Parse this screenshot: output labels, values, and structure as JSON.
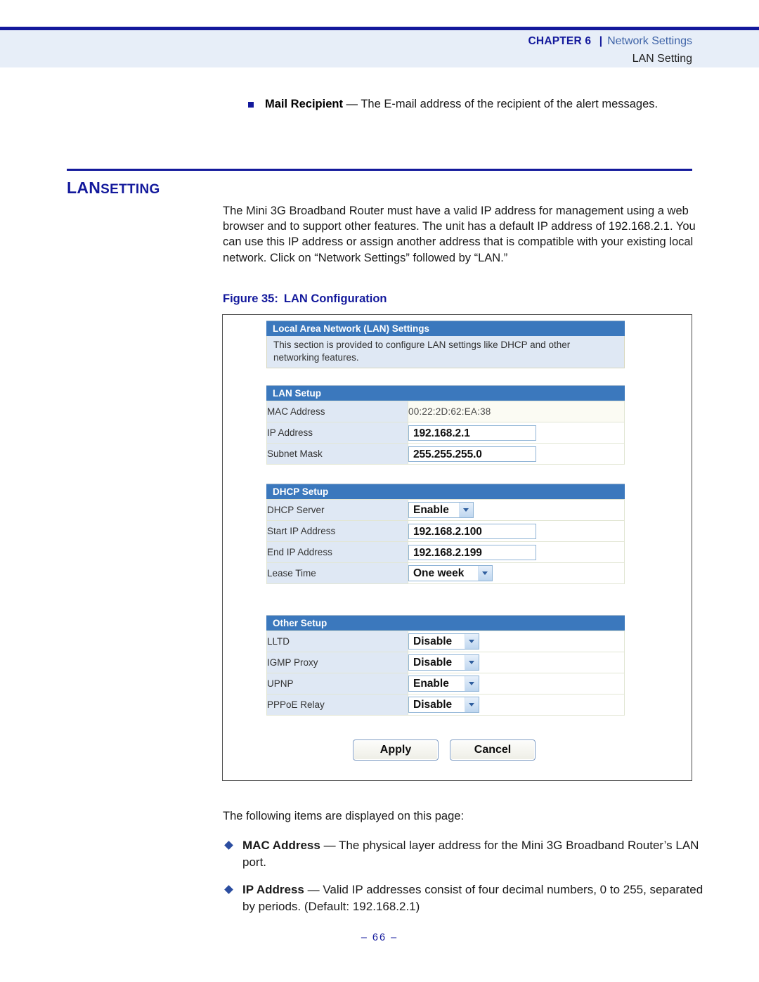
{
  "header": {
    "chapter_label": "CHAPTER",
    "chapter_number": "6",
    "separator": "|",
    "topic": "Network Settings",
    "subtitle": "LAN Setting"
  },
  "mail_recipient_item": {
    "bullet_icon": "square-bullet-icon",
    "term": "Mail Recipient",
    "dash": " — ",
    "description": "The E-mail address of the recipient of the alert messages."
  },
  "section": {
    "title_main": "LAN",
    "title_small": "SETTING",
    "intro": "The Mini 3G Broadband Router must have a valid IP address for management using a web browser and to support other features. The unit has a default IP address of 192.168.2.1. You can use this IP address or assign another address that is compatible with your existing local network. Click on “Network Settings” followed by “LAN.”"
  },
  "figure": {
    "caption_number": "Figure 35:",
    "caption_title": "LAN Configuration",
    "lan_settings_panel": {
      "title": "Local Area Network (LAN) Settings",
      "description": "This section is provided to configure LAN settings like DHCP and other networking features."
    },
    "lan_setup": {
      "title": "LAN Setup",
      "rows": [
        {
          "label": "MAC Address",
          "value": "00:22:2D:62:EA:38",
          "control": "text"
        },
        {
          "label": "IP Address",
          "value": "192.168.2.1",
          "control": "input"
        },
        {
          "label": "Subnet Mask",
          "value": "255.255.255.0",
          "control": "input"
        }
      ]
    },
    "dhcp_setup": {
      "title": "DHCP Setup",
      "rows": [
        {
          "label": "DHCP Server",
          "value": "Enable",
          "control": "select"
        },
        {
          "label": "Start IP Address",
          "value": "192.168.2.100",
          "control": "input"
        },
        {
          "label": "End IP Address",
          "value": "192.168.2.199",
          "control": "input"
        },
        {
          "label": "Lease Time",
          "value": "One week",
          "control": "select"
        }
      ]
    },
    "other_setup": {
      "title": "Other Setup",
      "rows": [
        {
          "label": "LLTD",
          "value": "Disable",
          "control": "select"
        },
        {
          "label": "IGMP Proxy",
          "value": "Disable",
          "control": "select"
        },
        {
          "label": "UPNP",
          "value": "Enable",
          "control": "select"
        },
        {
          "label": "PPPoE Relay",
          "value": "Disable",
          "control": "select"
        }
      ]
    },
    "buttons": {
      "apply": "Apply",
      "cancel": "Cancel"
    }
  },
  "body": {
    "following_items": "The following items are displayed on this page:",
    "items": [
      {
        "bullet_icon": "diamond-bullet-icon",
        "term": "MAC Address",
        "dash": " — ",
        "description": "The physical layer address for the Mini 3G Broadband Router’s LAN port."
      },
      {
        "bullet_icon": "diamond-bullet-icon",
        "term": "IP Address",
        "dash": " — ",
        "description": "Valid IP addresses consist of four decimal numbers, 0 to 255, separated by periods. (Default: 192.168.2.1)"
      }
    ]
  },
  "footer": {
    "page_number": "–  66  –"
  },
  "colors": {
    "navy": "#13199c",
    "header_band": "#e7eef8",
    "panel_blue": "#3b78bd",
    "panel_row_label": "#dfe8f4"
  }
}
